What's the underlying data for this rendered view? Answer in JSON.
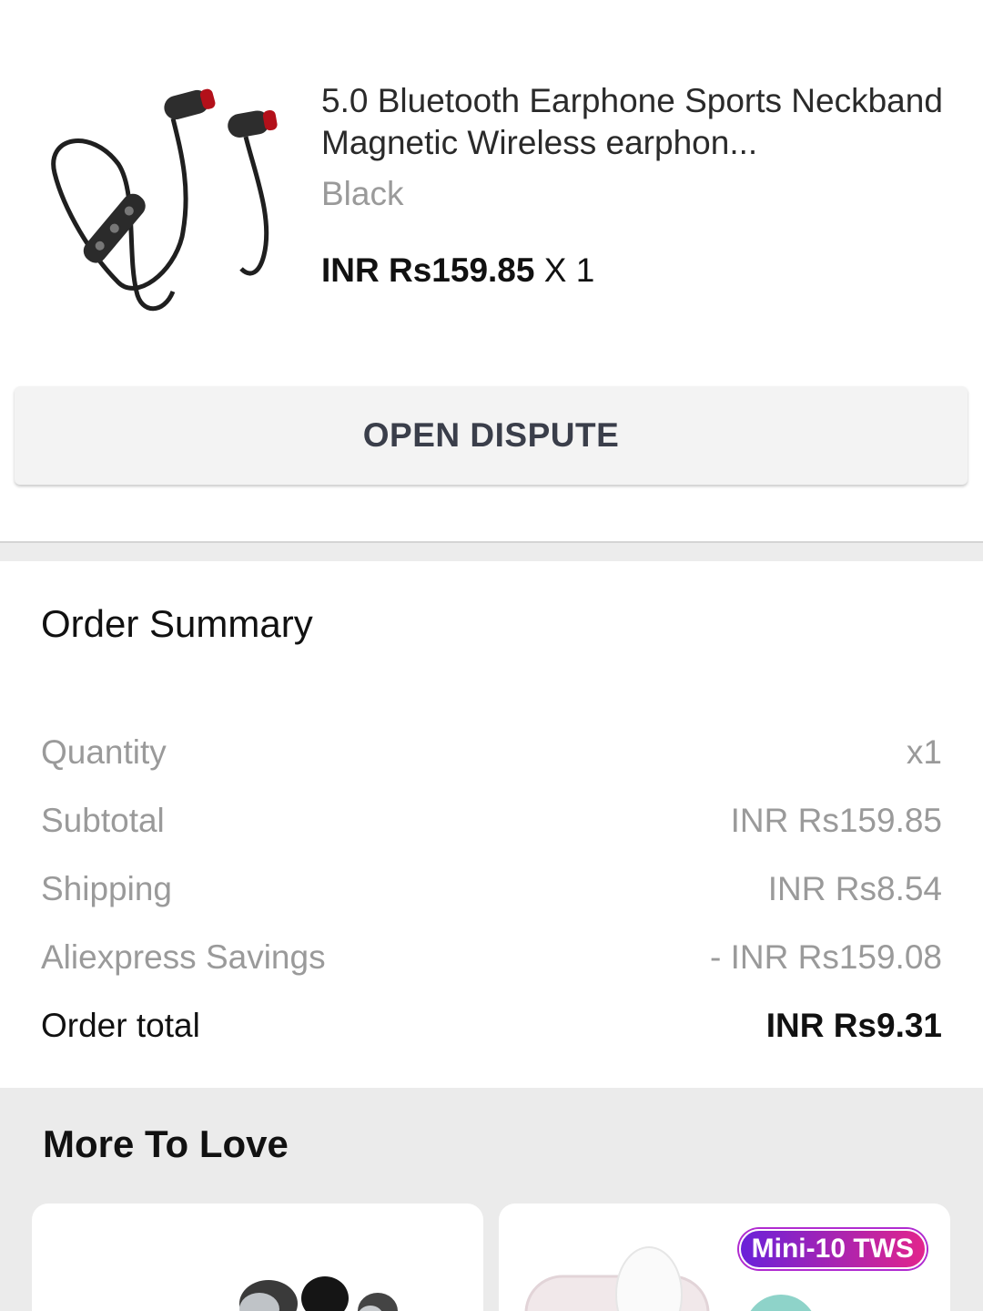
{
  "product": {
    "title": "5.0 Bluetooth Earphone Sports Neckband Magnetic Wireless earphon...",
    "variant": "Black",
    "price": "INR Rs159.85",
    "quantity_label": "X 1"
  },
  "actions": {
    "open_dispute_label": "OPEN DISPUTE"
  },
  "order_summary": {
    "title": "Order Summary",
    "rows": [
      {
        "label": "Quantity",
        "value": "x1"
      },
      {
        "label": "Subtotal",
        "value": "INR Rs159.85"
      },
      {
        "label": "Shipping",
        "value": "INR Rs8.54"
      },
      {
        "label": "Aliexpress Savings",
        "value": "- INR Rs159.08"
      }
    ],
    "total": {
      "label": "Order total",
      "value": "INR Rs9.31"
    }
  },
  "more_to_love": {
    "title": "More To Love",
    "cards": [
      {
        "badge": ""
      },
      {
        "badge": "Mini-10 TWS"
      }
    ]
  },
  "colors": {
    "muted_text": "#9a9a9a",
    "button_bg": "#f3f3f3",
    "badge_gradient_start": "#6a22d9",
    "badge_gradient_end": "#e2258c"
  }
}
